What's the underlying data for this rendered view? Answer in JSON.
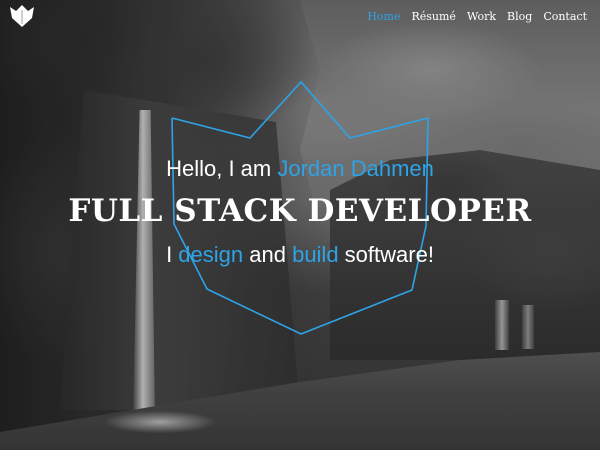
{
  "nav": {
    "items": [
      {
        "label": "Home",
        "active": true
      },
      {
        "label": "Résumé",
        "active": false
      },
      {
        "label": "Work",
        "active": false
      },
      {
        "label": "Blog",
        "active": false
      },
      {
        "label": "Contact",
        "active": false
      }
    ]
  },
  "hero": {
    "greeting_prefix": "Hello, I am ",
    "name": "Jordan Dahmen",
    "title": "FULL STACK DEVELOPER",
    "tagline": {
      "part1": "I ",
      "word1": "design",
      "part2": " and ",
      "word2": "build",
      "part3": " software!"
    }
  },
  "icons": {
    "logo": "crown-leaf-logo-icon",
    "emblem": "shield-crown-emblem-icon"
  },
  "colors": {
    "accent": "#2ea3e6",
    "text": "#ffffff",
    "background": "#5c5c5c"
  }
}
